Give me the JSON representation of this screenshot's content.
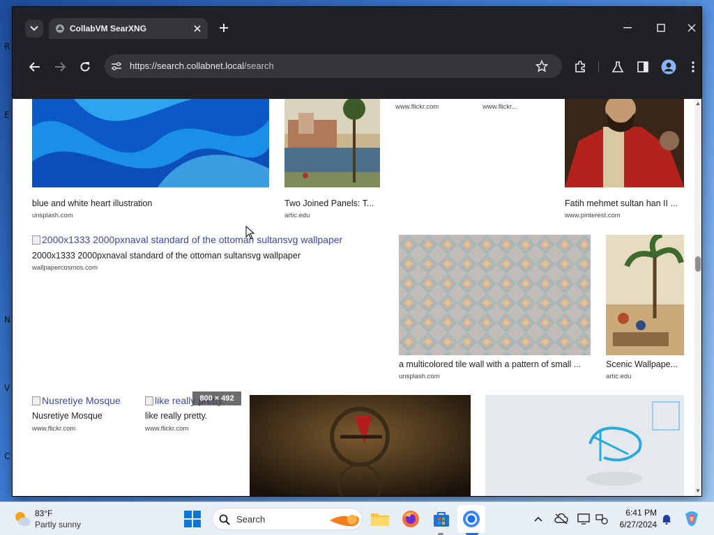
{
  "browser": {
    "tab_title": "CollabVM SearXNG",
    "url_host": "https://search.collabnet.local",
    "url_path": "/search"
  },
  "results_row1": [
    {
      "title": "blue and white heart illustration",
      "source": "unsplash.com"
    },
    {
      "title": "Two Joined Panels: T...",
      "source": "artic.edu"
    },
    {
      "source": "www.flickr.com"
    },
    {
      "source": "www.flickr..."
    },
    {
      "title": "Fatih mehmet sultan han II ...",
      "source": "www.pinterest.com"
    }
  ],
  "results_row2": [
    {
      "alt": "2000x1333 2000pxnaval standard of the ottoman sultansvg wallpaper",
      "title": "2000x1333 2000pxnaval standard of the ottoman sultansvg wallpaper",
      "source": "wallpapercosmos.com"
    },
    {
      "title": "a multicolored tile wall with a pattern of small ...",
      "source": "unsplash.com"
    },
    {
      "title": "Scenic Wallpape...",
      "source": "artic.edu"
    }
  ],
  "results_row3": [
    {
      "alt": "Nusretiye Mosque",
      "title": "Nusretiye Mosque",
      "source": "www.flickr.com"
    },
    {
      "alt": "like really pretty.",
      "title": "like really pretty.",
      "source": "www.flickr.com"
    }
  ],
  "size_badge": "800 × 492",
  "taskbar": {
    "weather_temp": "83°F",
    "weather_desc": "Partly sunny",
    "search_label": "Search",
    "time": "6:41 PM",
    "date": "6/27/2024"
  },
  "desktop_letters": [
    "R",
    "E",
    "N",
    "V",
    "C"
  ],
  "icons": [
    "chevron-down-icon",
    "favicon-icon",
    "close-icon",
    "plus-icon",
    "minimize-icon",
    "maximize-icon",
    "back-icon",
    "forward-icon",
    "reload-icon",
    "site-info-icon",
    "star-icon",
    "extensions-icon",
    "labs-icon",
    "side-panel-icon",
    "profile-icon",
    "menu-icon",
    "weather-icon",
    "windows-start-icon",
    "search-icon",
    "file-explorer-icon",
    "firefox-icon",
    "store-icon",
    "chrome-icon",
    "chevron-up-icon",
    "cloud-off-icon",
    "display-icon",
    "network-icon",
    "bell-icon",
    "copilot-icon"
  ],
  "colors": {
    "titlebar": "#202124",
    "link": "#3b4a9b",
    "taskbar": "#e8eef6",
    "accent": "#1f6fd6"
  }
}
